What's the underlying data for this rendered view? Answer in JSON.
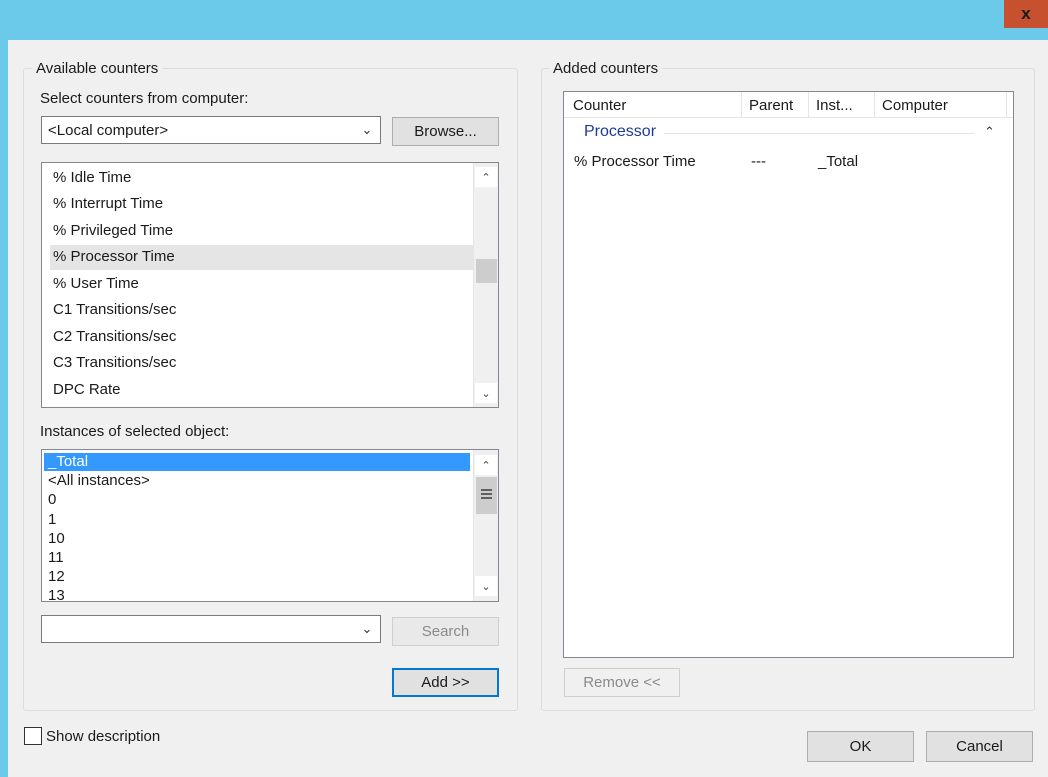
{
  "window": {
    "close_glyph": "x"
  },
  "available": {
    "group_label": "Available counters",
    "select_label": "Select counters from computer:",
    "computer_value": "<Local computer>",
    "browse_label": "Browse...",
    "counters": [
      "% Idle Time",
      "% Interrupt Time",
      "% Privileged Time",
      "% Processor Time",
      "% User Time",
      "C1 Transitions/sec",
      "C2 Transitions/sec",
      "C3 Transitions/sec",
      "DPC Rate"
    ],
    "instances_label": "Instances of selected object:",
    "instances": [
      "_Total",
      "<All instances>",
      "0",
      "1",
      "10",
      "11",
      "12",
      "13"
    ],
    "search_value": "",
    "search_label": "Search",
    "add_label": "Add >>"
  },
  "added": {
    "group_label": "Added counters",
    "columns": [
      "Counter",
      "Parent",
      "Inst...",
      "Computer"
    ],
    "group_name": "Processor",
    "rows": [
      {
        "counter": "% Processor Time",
        "parent": "---",
        "instance": "_Total",
        "computer": ""
      }
    ],
    "remove_label": "Remove <<"
  },
  "footer": {
    "show_description": "Show description",
    "ok_label": "OK",
    "cancel_label": "Cancel"
  }
}
